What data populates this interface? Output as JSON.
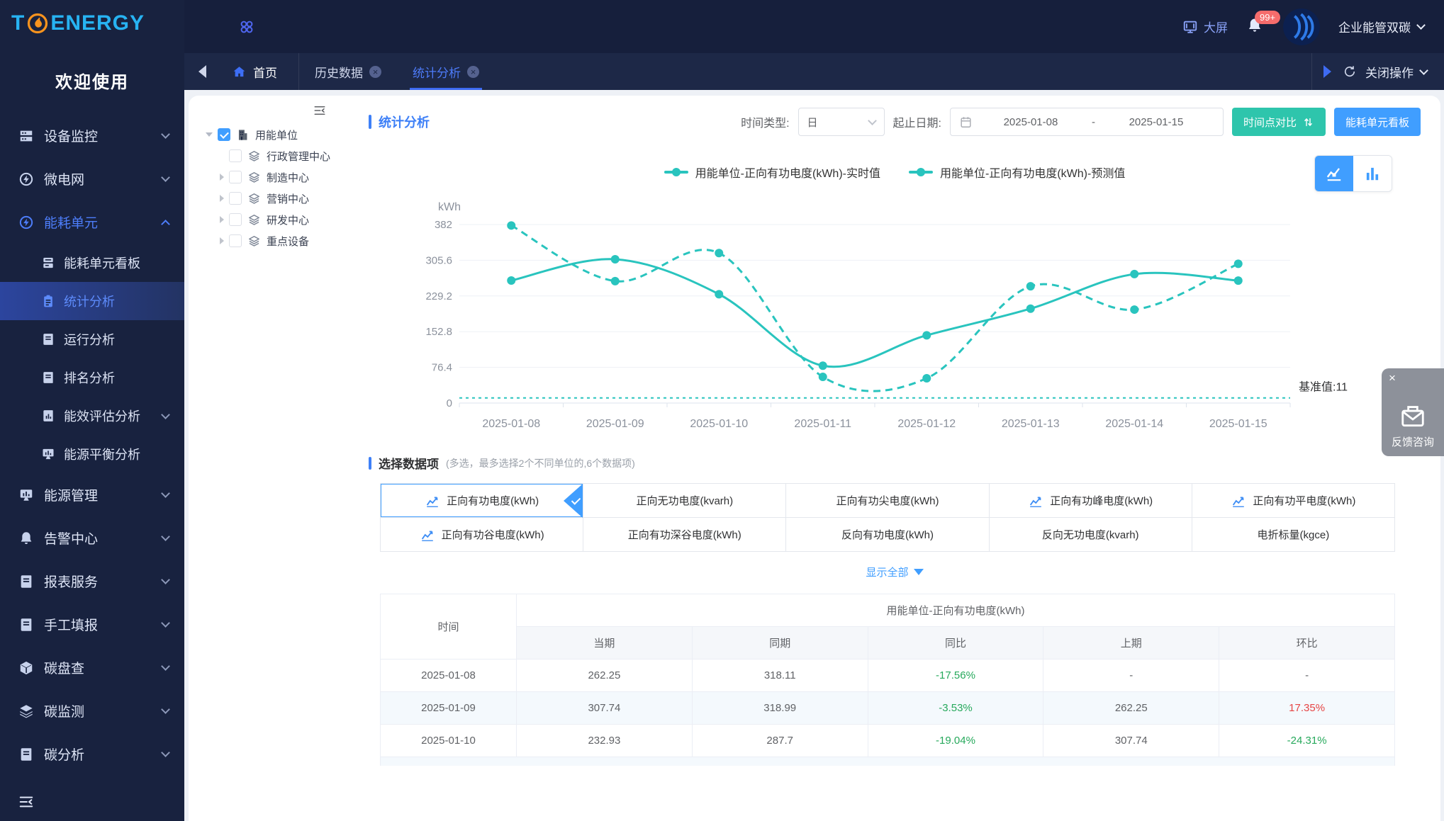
{
  "brand": {
    "logo_t": "T",
    "logo_rest": "ENERGY",
    "welcome": "欢迎使用"
  },
  "topbar": {
    "big_screen": "大屏",
    "badge": "99+",
    "org": "企业能管双碳"
  },
  "tabbar": {
    "tabs": [
      {
        "label": "首页",
        "active": false,
        "closable": false
      },
      {
        "label": "历史数据",
        "active": false,
        "closable": true
      },
      {
        "label": "统计分析",
        "active": true,
        "closable": true
      }
    ],
    "close_ops": "关闭操作"
  },
  "sidebar": {
    "items": [
      {
        "label": "设备监控"
      },
      {
        "label": "微电网"
      },
      {
        "label": "能耗单元",
        "active": true,
        "expanded": true
      },
      {
        "label": "能源管理"
      },
      {
        "label": "告警中心"
      },
      {
        "label": "报表服务"
      },
      {
        "label": "手工填报"
      },
      {
        "label": "碳盘查"
      },
      {
        "label": "碳监测"
      },
      {
        "label": "碳分析"
      }
    ],
    "sub_items": [
      {
        "label": "能耗单元看板"
      },
      {
        "label": "统计分析",
        "active": true
      },
      {
        "label": "运行分析"
      },
      {
        "label": "排名分析"
      },
      {
        "label": "能效评估分析"
      },
      {
        "label": "能源平衡分析"
      }
    ]
  },
  "tree": {
    "root": "用能单位",
    "root_checked": true,
    "children": [
      "行政管理中心",
      "制造中心",
      "营销中心",
      "研发中心",
      "重点设备"
    ]
  },
  "panel": {
    "title": "统计分析",
    "time_type_label": "时间类型:",
    "time_type_value": "日",
    "date_label": "起止日期:",
    "date_start": "2025-01-08",
    "date_sep": "-",
    "date_end": "2025-01-15",
    "btn_compare": "时间点对比",
    "btn_board": "能耗单元看板"
  },
  "chart_data": {
    "type": "line",
    "unit": "kWh",
    "color": "#29c4be",
    "categories": [
      "2025-01-08",
      "2025-01-09",
      "2025-01-10",
      "2025-01-11",
      "2025-01-12",
      "2025-01-13",
      "2025-01-14",
      "2025-01-15"
    ],
    "series": [
      {
        "name": "用能单位-正向有功电度(kWh)-实时值",
        "style": "solid",
        "values": [
          262.25,
          307.74,
          232.93,
          80,
          145,
          202,
          276,
          262
        ]
      },
      {
        "name": "用能单位-正向有功电度(kWh)-预测值",
        "style": "dashed",
        "values": [
          380,
          261,
          321,
          56,
          53,
          250,
          200,
          298
        ]
      }
    ],
    "yticks": [
      382,
      305.6,
      229.2,
      152.8,
      76.4,
      0
    ],
    "ylim": [
      0,
      382
    ],
    "baseline": {
      "label": "基准值:11",
      "value": 11
    },
    "legend_position": "top",
    "grid": true
  },
  "selector": {
    "title": "选择数据项",
    "hint": "(多选，最多选择2个不同单位的,6个数据项)",
    "show_all": "显示全部",
    "items": [
      {
        "label": "正向有功电度(kWh)",
        "selected": true,
        "icon": true
      },
      {
        "label": "正向无功电度(kvarh)",
        "selected": false,
        "icon": false
      },
      {
        "label": "正向有功尖电度(kWh)",
        "selected": false,
        "icon": false
      },
      {
        "label": "正向有功峰电度(kWh)",
        "selected": false,
        "icon": true
      },
      {
        "label": "正向有功平电度(kWh)",
        "selected": false,
        "icon": true
      },
      {
        "label": "正向有功谷电度(kWh)",
        "selected": false,
        "icon": true
      },
      {
        "label": "正向有功深谷电度(kWh)",
        "selected": false,
        "icon": false
      },
      {
        "label": "反向有功电度(kWh)",
        "selected": false,
        "icon": false
      },
      {
        "label": "反向无功电度(kvarh)",
        "selected": false,
        "icon": false
      },
      {
        "label": "电折标量(kgce)",
        "selected": false,
        "icon": false
      }
    ]
  },
  "table": {
    "col_time": "时间",
    "group_header": "用能单位-正向有功电度(kWh)",
    "subheaders": [
      "当期",
      "同期",
      "同比",
      "上期",
      "环比"
    ],
    "rows": [
      {
        "time": "2025-01-08",
        "current": "262.25",
        "same_period": "318.11",
        "yoy": "-17.56%",
        "prev": "-",
        "mom": "-"
      },
      {
        "time": "2025-01-09",
        "current": "307.74",
        "same_period": "318.99",
        "yoy": "-3.53%",
        "prev": "262.25",
        "mom": "17.35%"
      },
      {
        "time": "2025-01-10",
        "current": "232.93",
        "same_period": "287.7",
        "yoy": "-19.04%",
        "prev": "307.74",
        "mom": "-24.31%"
      }
    ]
  },
  "feedback": {
    "close": "×",
    "label": "反馈咨询"
  },
  "theme": {
    "accent": "#409eff",
    "teal_button": "#2ec5ac",
    "chart_line": "#29c4be",
    "green": "#27a95c",
    "red": "#e64545",
    "sidebar_active": "#4d7df9"
  }
}
